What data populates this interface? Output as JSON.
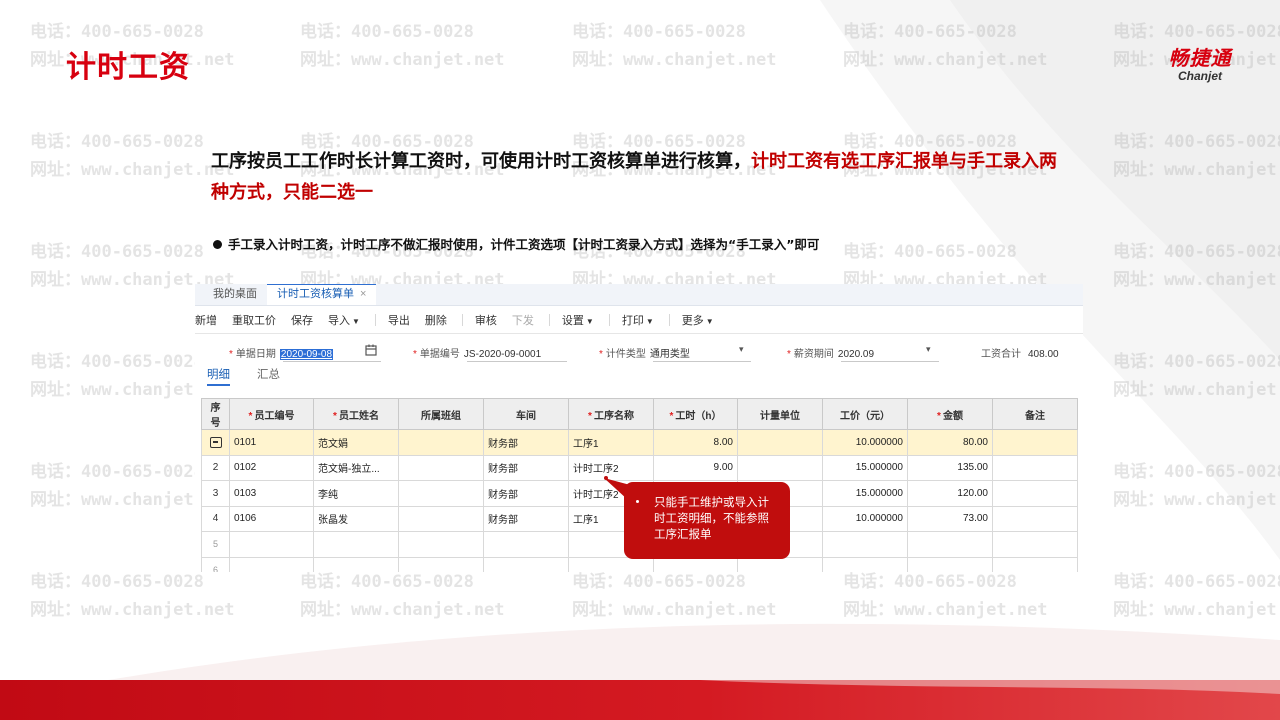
{
  "slide": {
    "title": "计时工资",
    "logo_cn": "畅捷通",
    "logo_en": "Chanjet",
    "intro_black": "工序按员工工作时长计算工资时，可使用计时工资核算单进行核算，",
    "intro_red": "计时工资有选工序汇报单与手工录入两种方式，只能二选一",
    "bullet": "手工录入计时工资，计时工序不做汇报时使用，计件工资选项【计时工资录入方式】选择为“手工录入”即可",
    "callout": "只能手工维护或导入计时工资明细，不能参照工序汇报单",
    "watermark_phone": "电话：400-665-0028",
    "watermark_web": "网址：www.chanjet.net",
    "colors": {
      "brand_red": "#d7000f",
      "accent_blue": "#2f6fd1",
      "selected_row": "#fff4cf"
    }
  },
  "app": {
    "tabs": [
      "我的桌面",
      "计时工资核算单"
    ],
    "close_glyph": "×",
    "toolbar": {
      "new": "新增",
      "reprice": "重取工价",
      "save": "保存",
      "import": "导入",
      "export": "导出",
      "delete": "删除",
      "audit": "审核",
      "dispatch": "下发",
      "settings": "设置",
      "print": "打印",
      "more": "更多"
    },
    "form": {
      "date_label": "单据日期",
      "date_value": "2020-09-08",
      "code_label": "单据编号",
      "code_value": "JS-2020-09-0001",
      "type_label": "计件类型",
      "type_value": "通用类型",
      "period_label": "薪资期间",
      "period_value": "2020.09",
      "total_label": "工资合计",
      "total_value": "408.00"
    },
    "subtabs": [
      "明细",
      "汇总"
    ],
    "columns": [
      "序号",
      "员工编号",
      "员工姓名",
      "所属班组",
      "车间",
      "工序名称",
      "工时（h）",
      "计量单位",
      "工价（元）",
      "金额",
      "备注"
    ],
    "rows": [
      {
        "no": "",
        "emp_code": "0101",
        "emp_name": "范文娟",
        "team": "",
        "workshop": "财务部",
        "process": "工序1",
        "hours": "8.00",
        "unit": "",
        "price": "10.000000",
        "amount": "80.00",
        "note": ""
      },
      {
        "no": "2",
        "emp_code": "0102",
        "emp_name": "范文娟-独立...",
        "team": "",
        "workshop": "财务部",
        "process": "计时工序2",
        "hours": "9.00",
        "unit": "",
        "price": "15.000000",
        "amount": "135.00",
        "note": ""
      },
      {
        "no": "3",
        "emp_code": "0103",
        "emp_name": "李纯",
        "team": "",
        "workshop": "财务部",
        "process": "计时工序2",
        "hours": "",
        "unit": "",
        "price": "15.000000",
        "amount": "120.00",
        "note": ""
      },
      {
        "no": "4",
        "emp_code": "0106",
        "emp_name": "张晶发",
        "team": "",
        "workshop": "财务部",
        "process": "工序1",
        "hours": "",
        "unit": "",
        "price": "10.000000",
        "amount": "73.00",
        "note": ""
      },
      {
        "no": "5",
        "emp_code": "",
        "emp_name": "",
        "team": "",
        "workshop": "",
        "process": "",
        "hours": "",
        "unit": "",
        "price": "",
        "amount": "",
        "note": ""
      },
      {
        "no": "6",
        "emp_code": "",
        "emp_name": "",
        "team": "",
        "workshop": "",
        "process": "",
        "hours": "",
        "unit": "",
        "price": "",
        "amount": "",
        "note": ""
      }
    ]
  }
}
